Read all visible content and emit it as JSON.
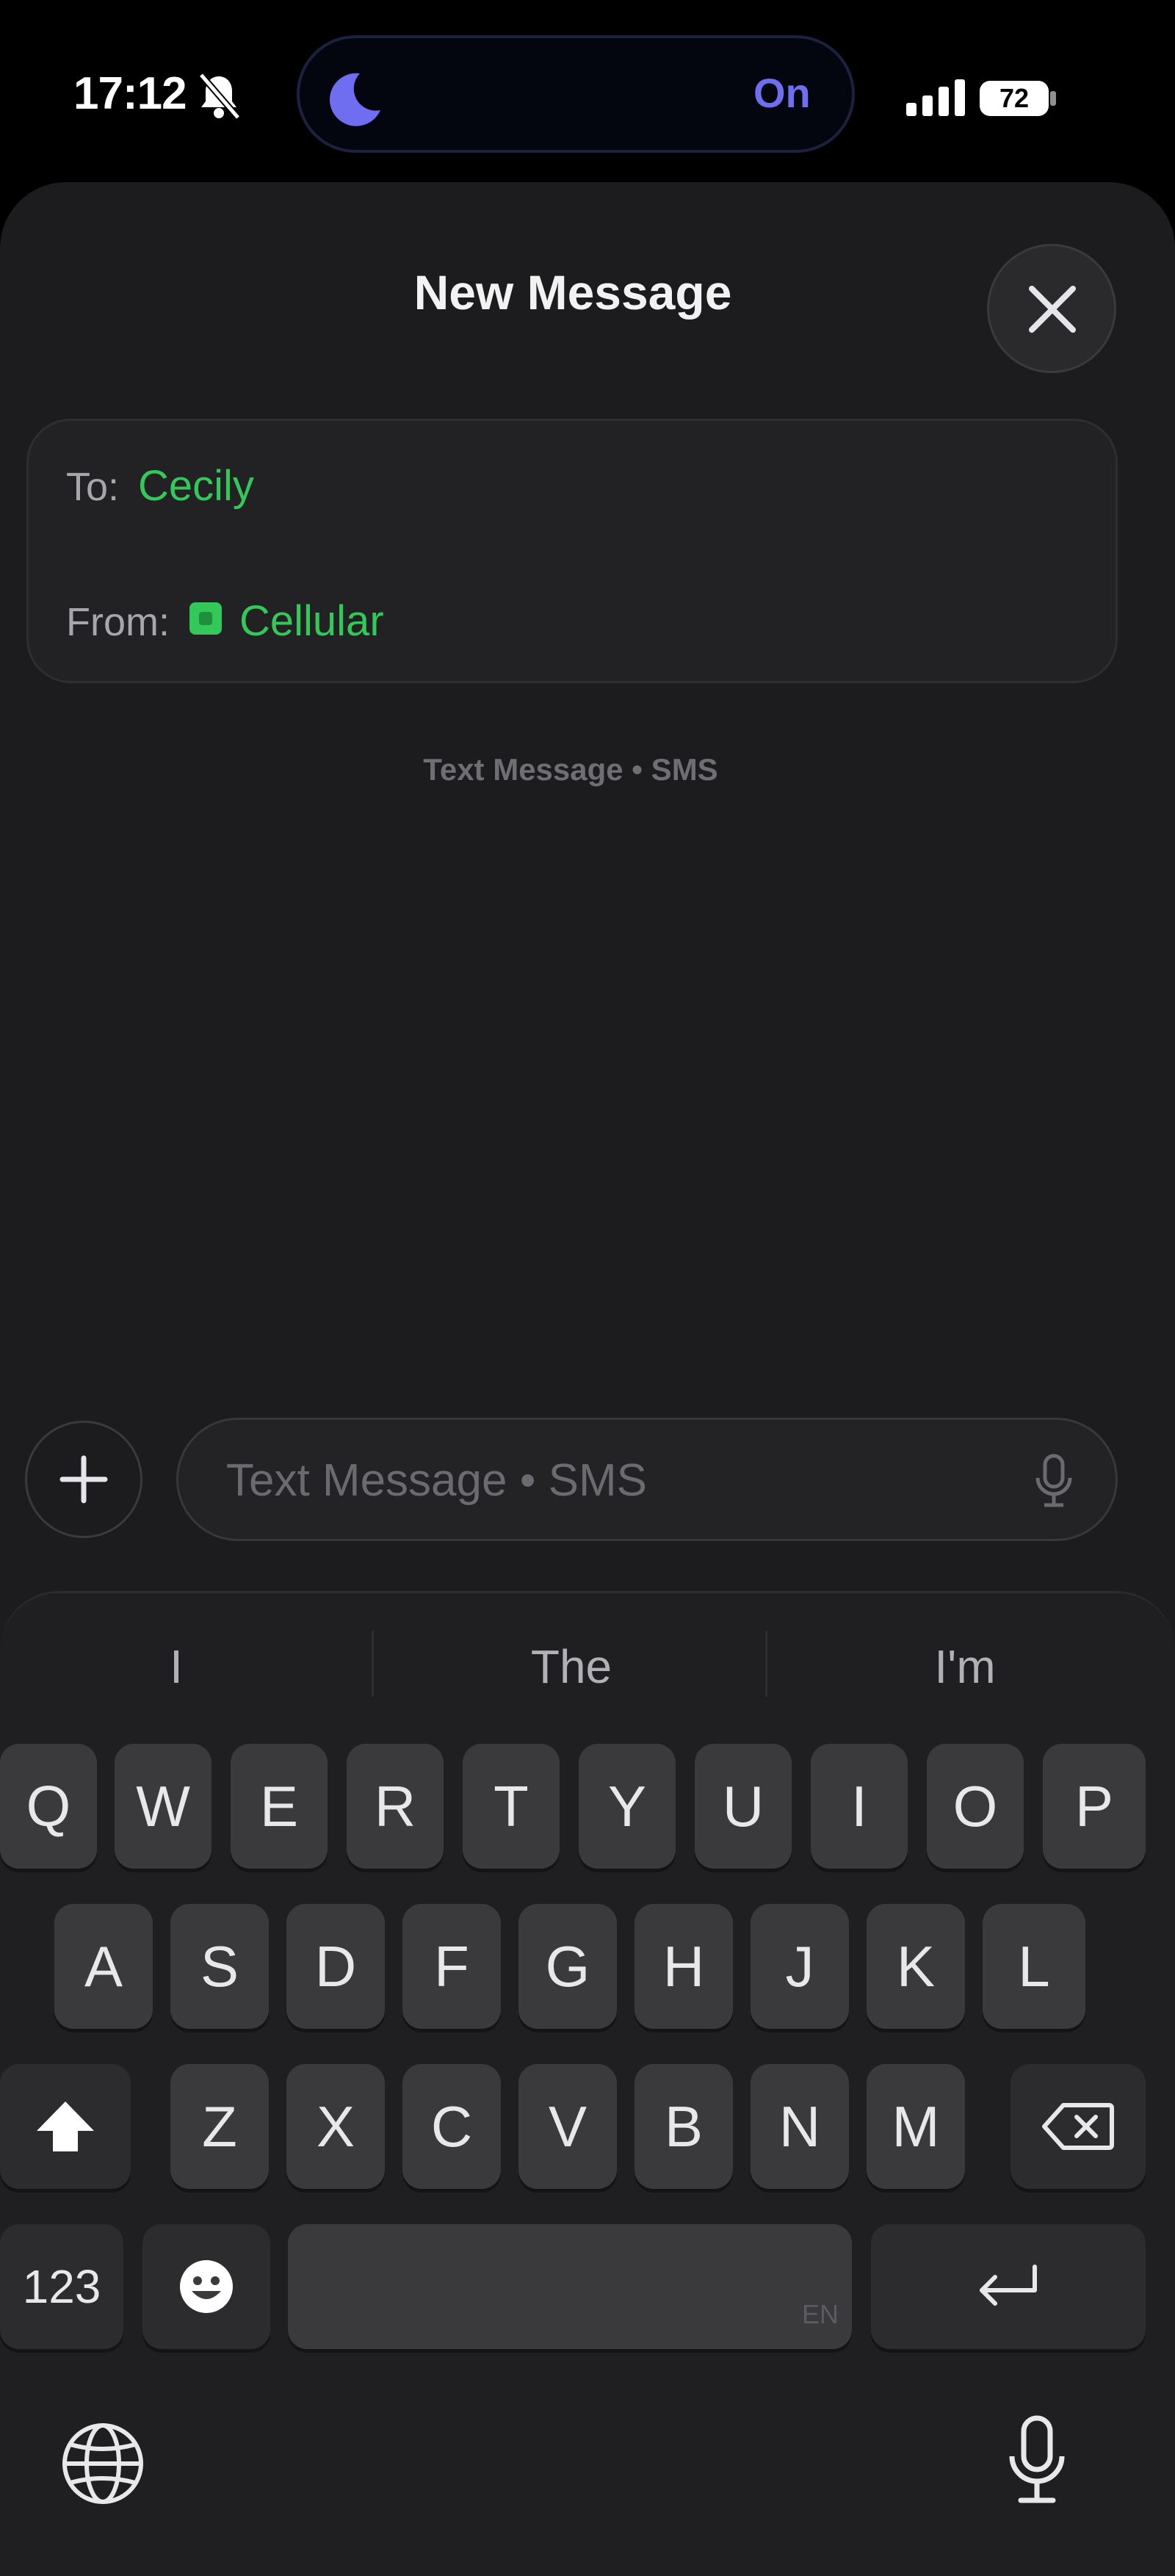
{
  "status_bar": {
    "time": "17:12",
    "focus_state": "On",
    "battery_percent": "72"
  },
  "sheet": {
    "title": "New Message"
  },
  "header": {
    "to_label": "To:",
    "to_value": "Cecily",
    "from_label": "From:",
    "from_value": "Cellular"
  },
  "caption": "Text Message • SMS",
  "compose": {
    "placeholder": "Text Message • SMS"
  },
  "suggestions": [
    "I",
    "The",
    "I'm"
  ],
  "keyboard": {
    "row1": [
      "Q",
      "W",
      "E",
      "R",
      "T",
      "Y",
      "U",
      "I",
      "O",
      "P"
    ],
    "row2": [
      "A",
      "S",
      "D",
      "F",
      "G",
      "H",
      "J",
      "K",
      "L"
    ],
    "row3": [
      "Z",
      "X",
      "C",
      "V",
      "B",
      "N",
      "M"
    ],
    "numbers_label": "123",
    "language_tag": "EN"
  },
  "colors": {
    "accent_green": "#34c759",
    "focus_purple": "#6f6ef0"
  },
  "icons": [
    "bell-slash-icon",
    "moon-icon",
    "signal-icon",
    "battery-icon",
    "close-icon",
    "plus-icon",
    "microphone-icon",
    "shift-icon",
    "delete-icon",
    "emoji-icon",
    "return-icon",
    "globe-icon"
  ]
}
